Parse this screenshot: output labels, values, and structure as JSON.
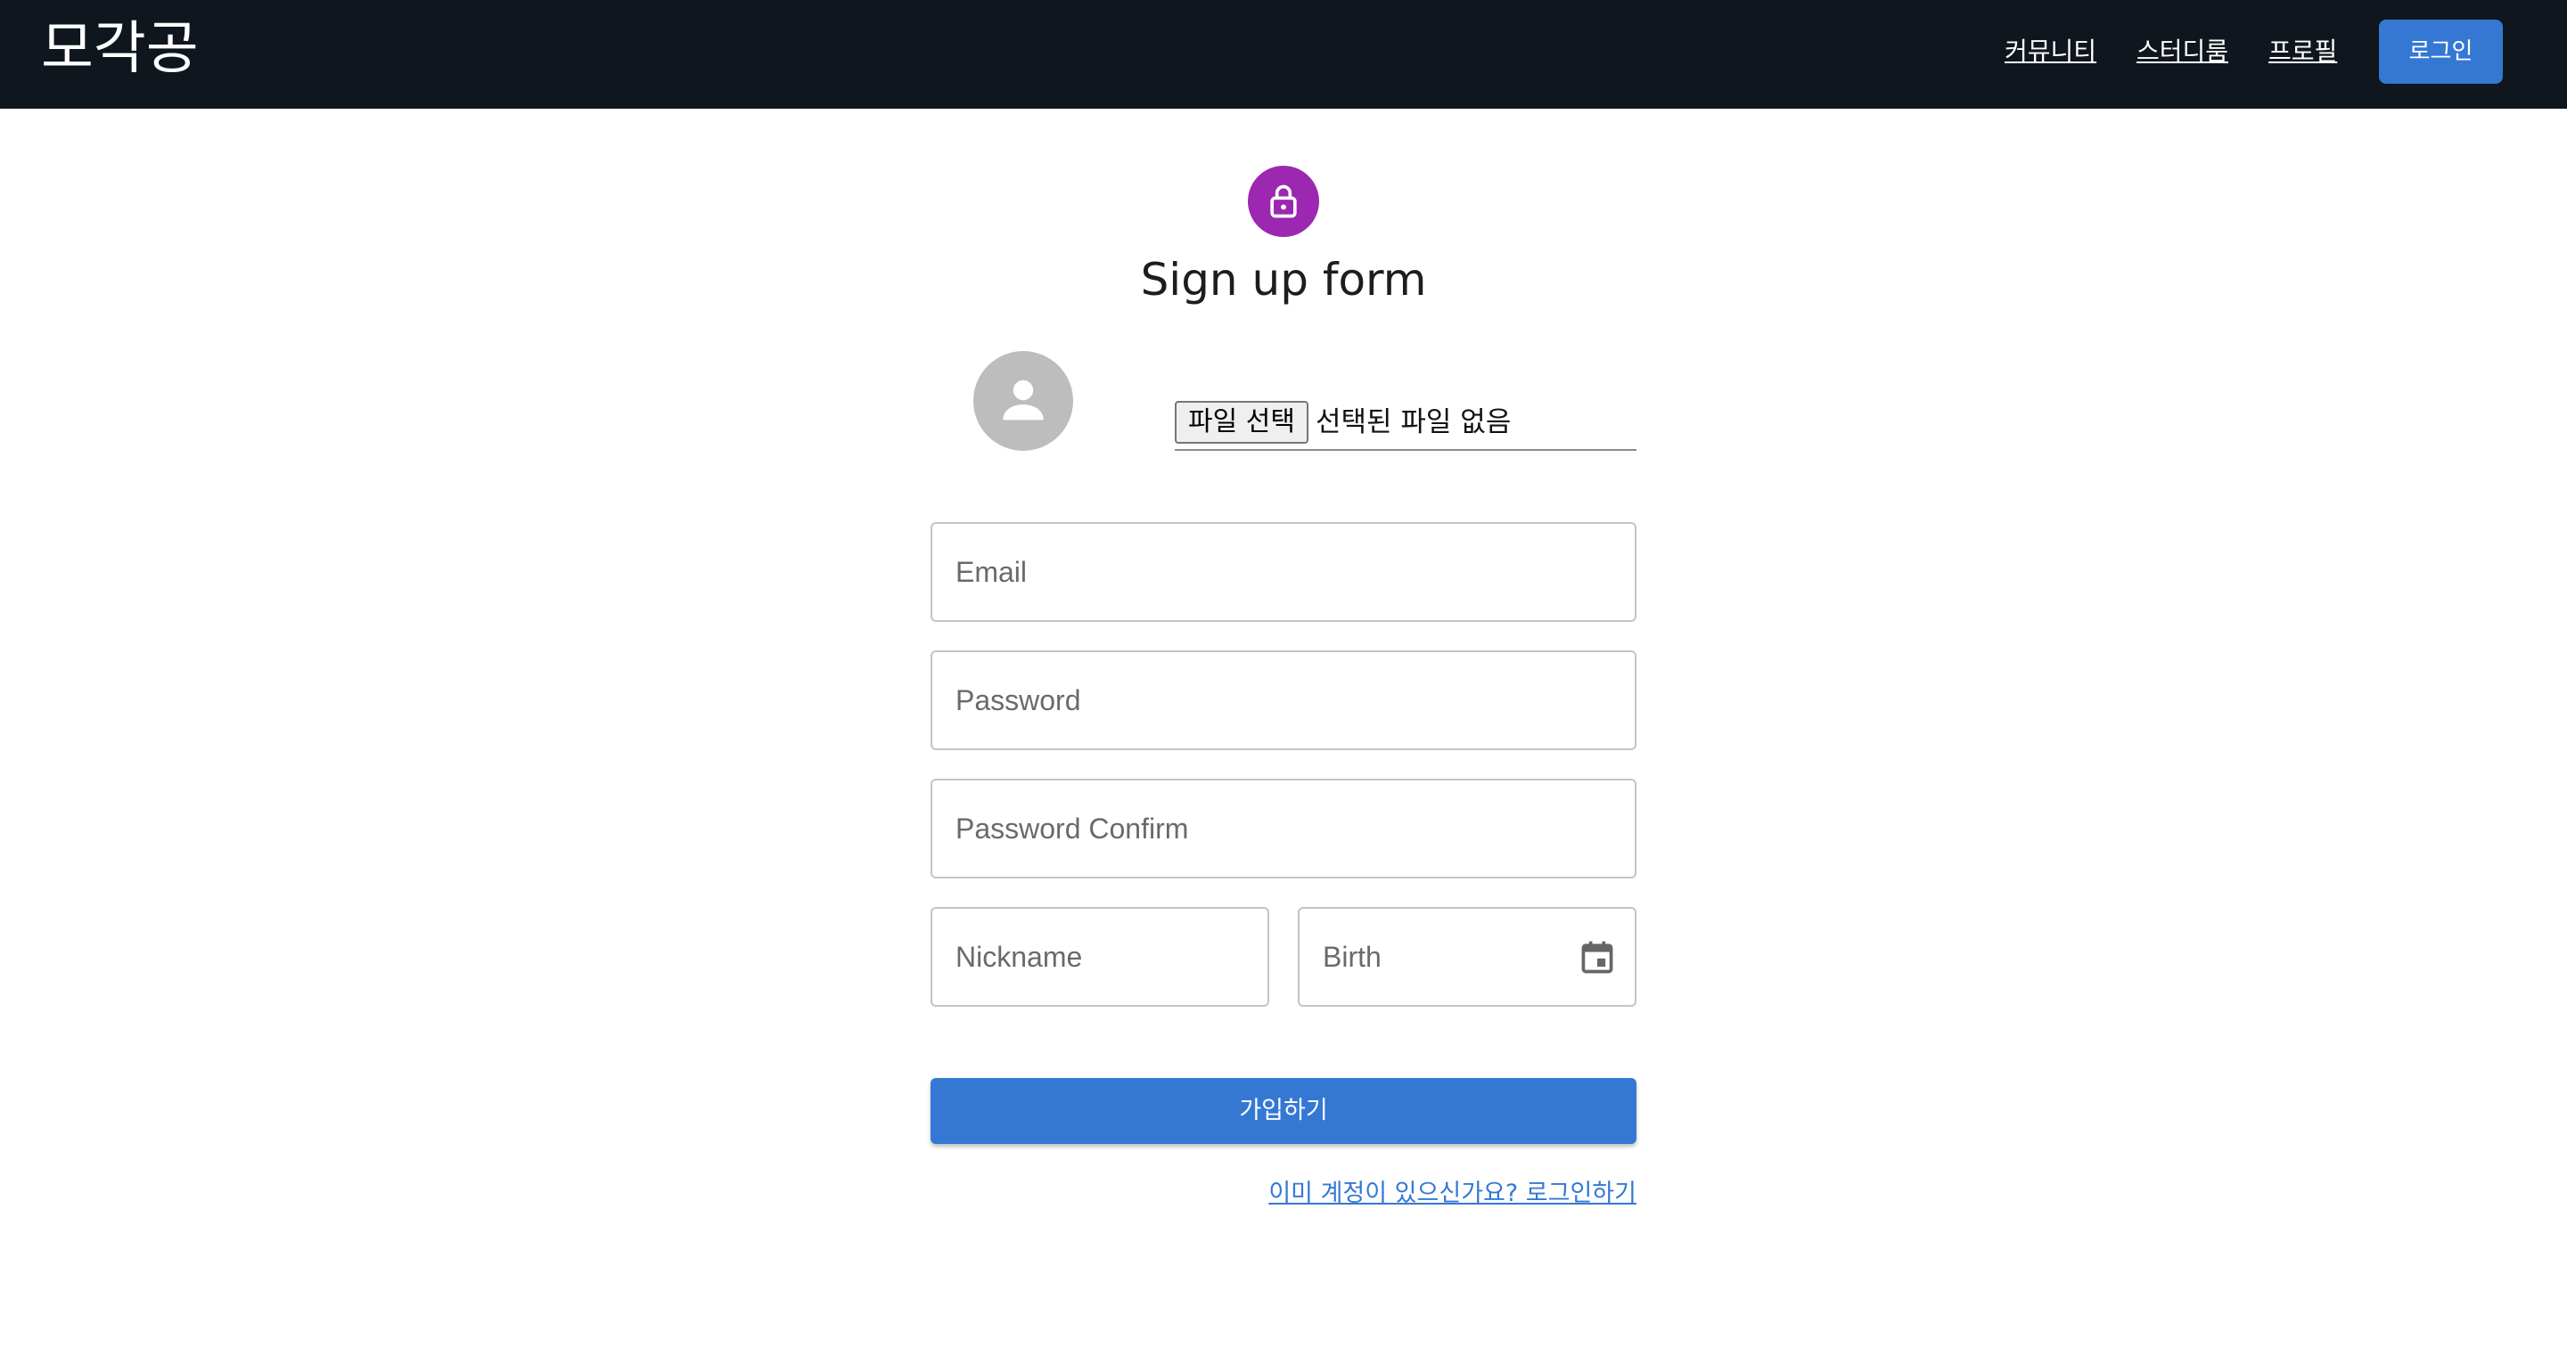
{
  "navbar": {
    "brand": "모각공",
    "links": [
      "커뮤니티",
      "스터디룸",
      "프로필"
    ],
    "login_button": "로그인"
  },
  "form": {
    "lock_icon": "lock-icon",
    "title": "Sign up form",
    "avatar_icon": "person-icon",
    "file_button": "파일 선택",
    "file_status": "선택된 파일 없음",
    "email_placeholder": "Email",
    "password_placeholder": "Password",
    "password_confirm_placeholder": "Password Confirm",
    "nickname_placeholder": "Nickname",
    "birth_placeholder": "Birth",
    "calendar_icon": "calendar-icon",
    "submit_label": "가입하기",
    "signin_link": "이미 계정이 있으신가요? 로그인하기"
  },
  "colors": {
    "navbar_bg": "#0f161e",
    "primary": "#3478d4",
    "lock_avatar": "#9c27b0",
    "profile_avatar": "#bdbdbd"
  }
}
